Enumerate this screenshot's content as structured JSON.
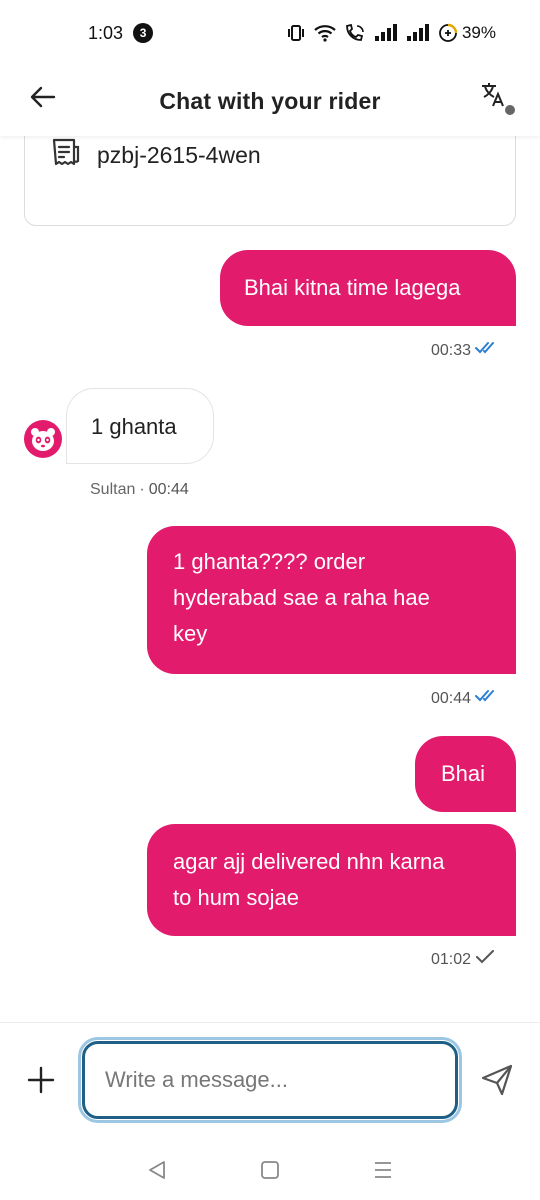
{
  "status_bar": {
    "time": "1:03",
    "notification_count": "3",
    "battery_percent": "39%"
  },
  "header": {
    "title": "Chat with your rider",
    "back_icon": "arrow-left-icon",
    "translate_icon": "translate-icon"
  },
  "order": {
    "code": "pzbj-2615-4wen",
    "icon": "receipt-icon"
  },
  "messages": [
    {
      "direction": "out",
      "text": "Bhai kitna time lagega",
      "time": "00:33",
      "status": "read"
    },
    {
      "direction": "in",
      "text": "1 ghanta",
      "sender": "Sultan",
      "separator": "·",
      "time": "00:44"
    },
    {
      "direction": "out",
      "lines": [
        "1 ghanta???? order",
        "hyderabad sae a raha hae",
        "key"
      ],
      "time": "00:44",
      "status": "read"
    },
    {
      "direction": "out",
      "text": "Bhai"
    },
    {
      "direction": "out",
      "lines": [
        "agar ajj delivered nhn karna",
        "to hum sojae"
      ],
      "time": "01:02",
      "status": "sent"
    }
  ],
  "composer": {
    "placeholder": "Write a message...",
    "value": ""
  },
  "colors": {
    "accent": "#e21b6d",
    "read_tick": "#2a7fd4",
    "sent_tick": "#555555",
    "input_border": "#1f5f86"
  }
}
